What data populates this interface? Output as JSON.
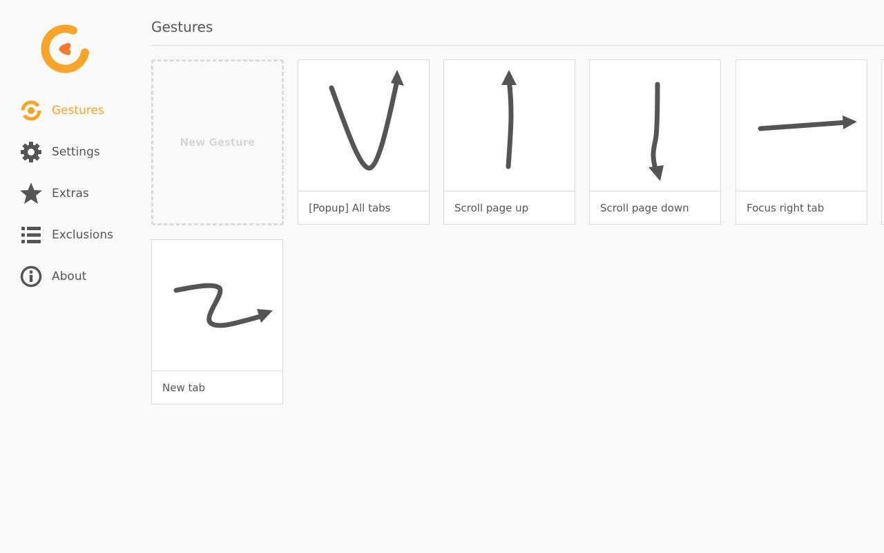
{
  "sidebar": {
    "logo_icon": "gesturefy-logo",
    "items": [
      {
        "label": "Gestures",
        "icon": "gestures-icon",
        "active": true
      },
      {
        "label": "Settings",
        "icon": "gear-icon",
        "active": false
      },
      {
        "label": "Extras",
        "icon": "star-icon",
        "active": false
      },
      {
        "label": "Exclusions",
        "icon": "list-icon",
        "active": false
      },
      {
        "label": "About",
        "icon": "info-icon",
        "active": false
      }
    ]
  },
  "main": {
    "title": "Gestures",
    "new_gesture_label": "New Gesture",
    "gestures": [
      {
        "label": "[Popup] All tabs",
        "shape": "v-up"
      },
      {
        "label": "Scroll page up",
        "shape": "line-up"
      },
      {
        "label": "Scroll page down",
        "shape": "line-down"
      },
      {
        "label": "Focus right tab",
        "shape": "line-right"
      },
      {
        "label": "New tab",
        "shape": "z-right"
      }
    ]
  },
  "colors": {
    "accent": "#F7A42A",
    "accent_secondary": "#F47B2B",
    "text": "#555555",
    "stroke": "#555555",
    "background": "#fafafa"
  }
}
